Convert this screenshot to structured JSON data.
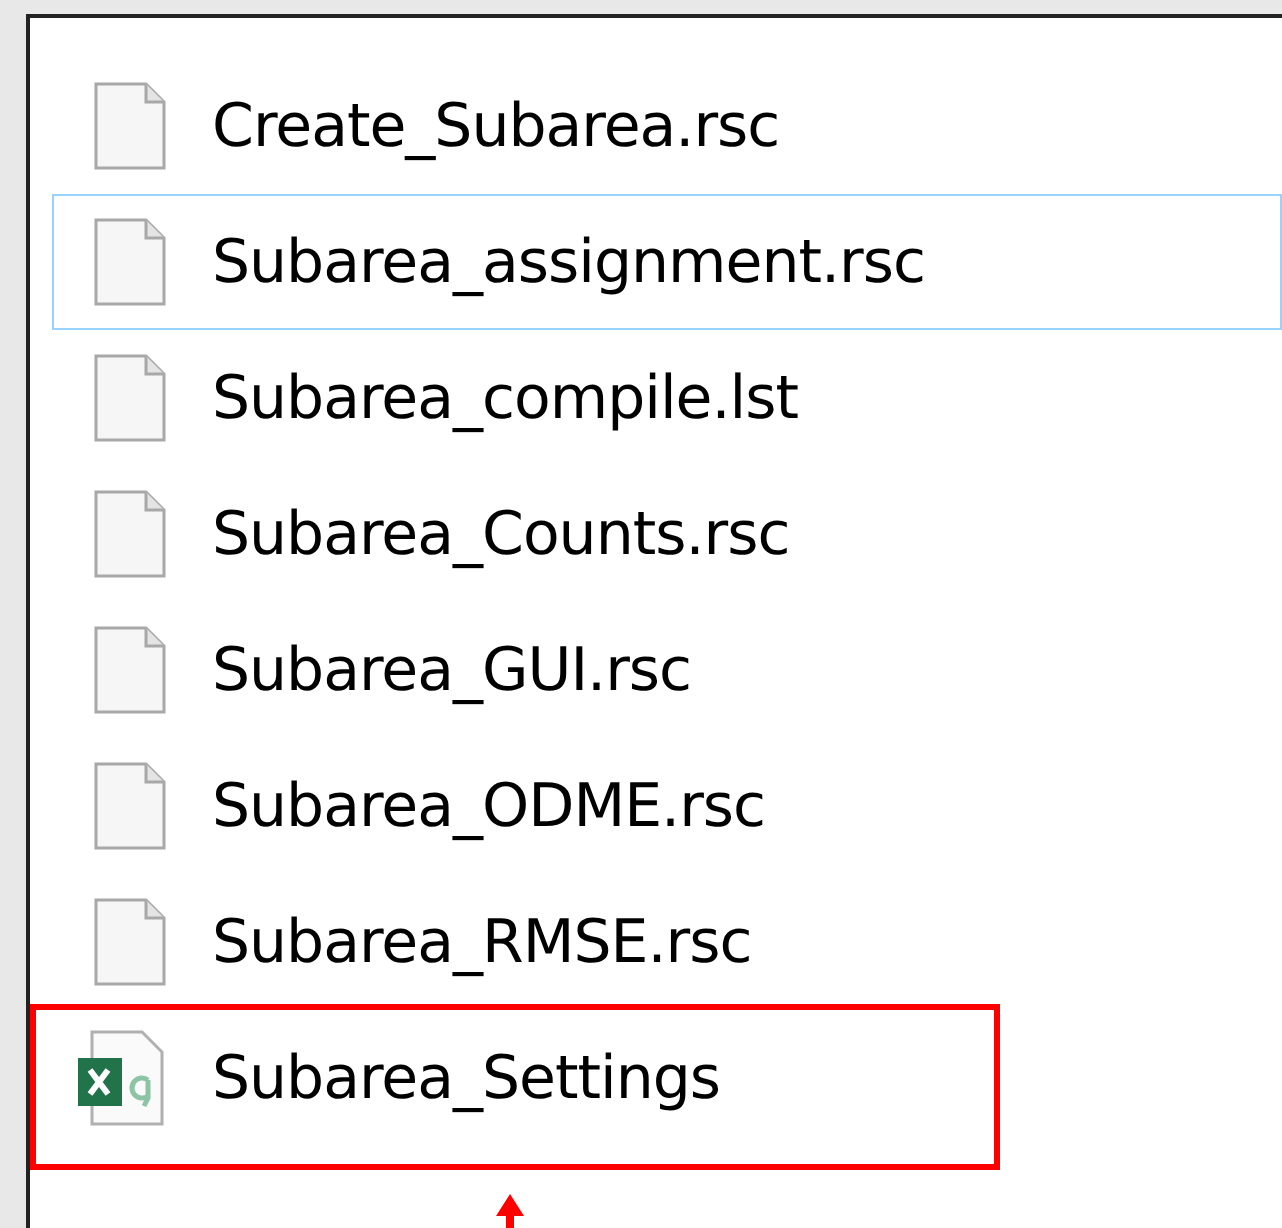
{
  "files": [
    {
      "name": "Create_Subarea.rsc",
      "kind": "file",
      "hovered": false,
      "annotated": false
    },
    {
      "name": "Subarea_assignment.rsc",
      "kind": "file",
      "hovered": true,
      "annotated": false
    },
    {
      "name": "Subarea_compile.lst",
      "kind": "file",
      "hovered": false,
      "annotated": false
    },
    {
      "name": "Subarea_Counts.rsc",
      "kind": "file",
      "hovered": false,
      "annotated": false
    },
    {
      "name": "Subarea_GUI.rsc",
      "kind": "file",
      "hovered": false,
      "annotated": false
    },
    {
      "name": "Subarea_ODME.rsc",
      "kind": "file",
      "hovered": false,
      "annotated": false
    },
    {
      "name": "Subarea_RMSE.rsc",
      "kind": "file",
      "hovered": false,
      "annotated": false
    },
    {
      "name": "Subarea_Settings",
      "kind": "spreadsheet",
      "hovered": false,
      "annotated": true
    }
  ]
}
